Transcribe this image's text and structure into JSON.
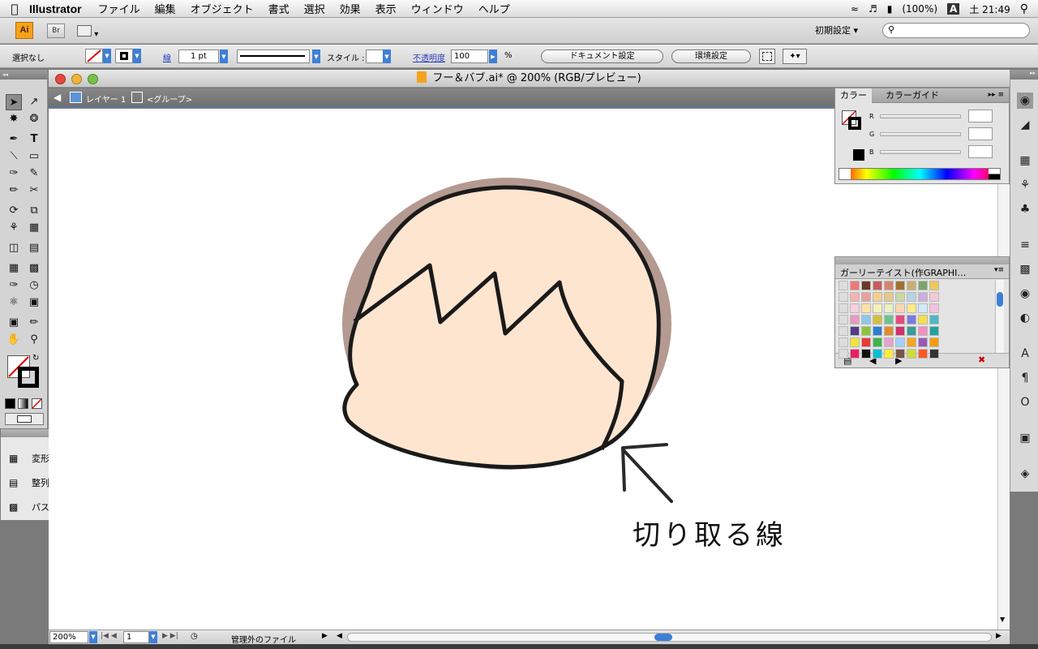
{
  "menubar": {
    "app_name": "Illustrator",
    "items": [
      "ファイル",
      "編集",
      "オブジェクト",
      "書式",
      "選択",
      "効果",
      "表示",
      "ウィンドウ",
      "ヘルプ"
    ],
    "battery": "(100%)",
    "input_method": "A",
    "clock": "土 21:49"
  },
  "appbar": {
    "logo": "Ai",
    "bridge": "Br",
    "workspace": "初期設定 ▾"
  },
  "control": {
    "selection": "選択なし",
    "stroke_label": "線",
    "stroke_weight": "1 pt",
    "style_label": "スタイル :",
    "opacity_label": "不透明度",
    "opacity_value": "100",
    "percent": "%",
    "doc_setup": "ドキュメント設定",
    "prefs": "環境設定"
  },
  "document": {
    "title": "フー＆バブ.ai* @ 200% (RGB/プレビュー)",
    "layer": "レイヤー 1",
    "group": "<グループ>",
    "annotation": "切り取る線"
  },
  "status": {
    "zoom": "200%",
    "page": "1",
    "info": "管理外のファイル"
  },
  "float_panel": {
    "items": [
      "変形",
      "整列",
      "パスファインダ"
    ]
  },
  "color_panel": {
    "tab_color": "カラー",
    "tab_guide": "カラーガイド",
    "r": "R",
    "g": "G",
    "b": "B"
  },
  "swatch_panel": {
    "title": "ガーリーテイスト(作GRAPHI…"
  },
  "colors": {
    "face": "#fde5d0",
    "shadow": "#b59a91",
    "outline": "#1a1a1a"
  }
}
